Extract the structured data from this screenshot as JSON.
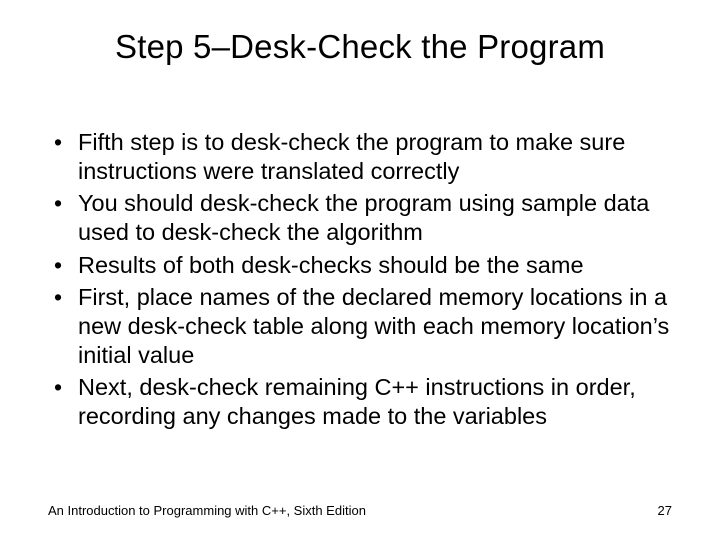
{
  "slide": {
    "title": "Step 5–Desk-Check the Program",
    "bullets": [
      "Fifth step is to desk-check the program to make sure instructions were translated correctly",
      "You should desk-check the program using sample data used to desk-check the algorithm",
      "Results of both desk-checks should be the same",
      "First, place names of the declared memory locations in a new desk-check table along with each memory location’s initial value",
      "Next, desk-check remaining C++ instructions in order, recording any changes made to the variables"
    ],
    "footer_left": "An Introduction to Programming with C++, Sixth Edition",
    "page_number": "27"
  }
}
